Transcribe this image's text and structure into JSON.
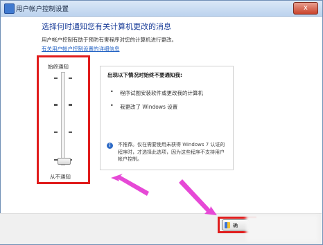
{
  "window": {
    "title": "用户帐户控制设置",
    "close_symbol": "x"
  },
  "header": {
    "heading": "选择何时通知您有关计算机更改的消息",
    "description": "用户帐户控制有助于预防有害程序对您的计算机进行更改。",
    "link": "有关用户帐户控制设置的详细信息"
  },
  "slider": {
    "top_label": "始终通知",
    "bottom_label": "从不通知",
    "level": 0,
    "levels": 4
  },
  "info": {
    "title": "出现以下情况时始终不要通知我:",
    "bullets": [
      "程序试图安装软件或更改我的计算机",
      "我更改了 Windows 设置"
    ],
    "note": "不推荐。仅在需要使用未获得 Windows 7 认证的程序时，才选择此选项，因为这些程序不支持用户帐户控制。"
  },
  "footer": {
    "ok_label": "确"
  },
  "colors": {
    "highlight": "#e01d1d",
    "arrow": "#e649d6",
    "link": "#2262c4",
    "heading": "#1c3f9a"
  }
}
